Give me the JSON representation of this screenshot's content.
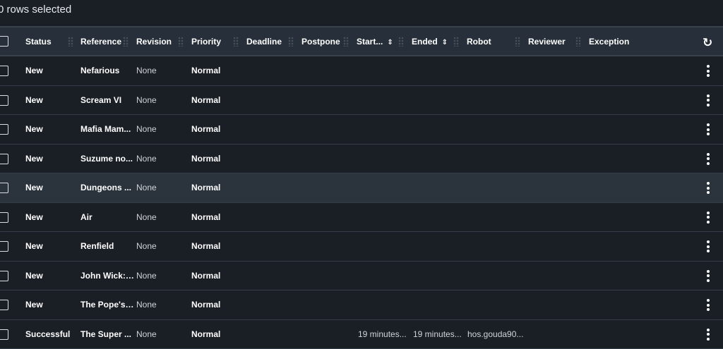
{
  "selection_text": "0 rows selected",
  "columns": [
    "Status",
    "Reference",
    "Revision",
    "Priority",
    "Deadline",
    "Postpone",
    "Start...",
    "Ended",
    "Robot",
    "Reviewer",
    "Exception"
  ],
  "rows": [
    {
      "status": "New",
      "reference": "Nefarious",
      "revision": "None",
      "priority": "Normal",
      "start": "",
      "ended": "",
      "robot": ""
    },
    {
      "status": "New",
      "reference": "Scream VI",
      "revision": "None",
      "priority": "Normal",
      "start": "",
      "ended": "",
      "robot": ""
    },
    {
      "status": "New",
      "reference": "Mafia Mam...",
      "revision": "None",
      "priority": "Normal",
      "start": "",
      "ended": "",
      "robot": ""
    },
    {
      "status": "New",
      "reference": "Suzume no...",
      "revision": "None",
      "priority": "Normal",
      "start": "",
      "ended": "",
      "robot": ""
    },
    {
      "status": "New",
      "reference": "Dungeons ...",
      "revision": "None",
      "priority": "Normal",
      "start": "",
      "ended": "",
      "robot": ""
    },
    {
      "status": "New",
      "reference": "Air",
      "revision": "None",
      "priority": "Normal",
      "start": "",
      "ended": "",
      "robot": ""
    },
    {
      "status": "New",
      "reference": "Renfield",
      "revision": "None",
      "priority": "Normal",
      "start": "",
      "ended": "",
      "robot": ""
    },
    {
      "status": "New",
      "reference": "John Wick: ...",
      "revision": "None",
      "priority": "Normal",
      "start": "",
      "ended": "",
      "robot": ""
    },
    {
      "status": "New",
      "reference": "The Pope's ...",
      "revision": "None",
      "priority": "Normal",
      "start": "",
      "ended": "",
      "robot": ""
    },
    {
      "status": "Successful",
      "reference": "The Super ...",
      "revision": "None",
      "priority": "Normal",
      "start": "19 minutes...",
      "ended": "19 minutes...",
      "robot": "hos.gouda90..."
    }
  ]
}
